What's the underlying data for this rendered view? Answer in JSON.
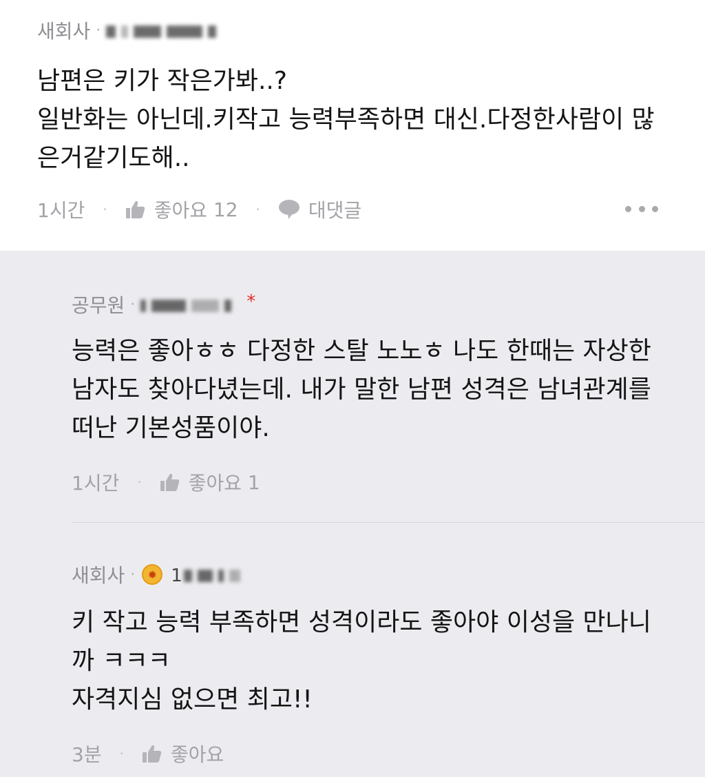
{
  "comments": [
    {
      "author_role": "새회사",
      "body_lines": [
        "남편은 키가 작은가봐..?",
        "일반화는 아닌데.키작고 능력부족하면 대신.다정한사람이 많",
        "은거같기도해.."
      ],
      "time": "1시간",
      "like_label": "좋아요",
      "like_count": "12",
      "reply_label": "대댓글"
    }
  ],
  "replies": [
    {
      "author_role": "공무원",
      "body_lines": [
        "능력은 좋아ㅎㅎ 다정한 스탈 노노ㅎ 나도 한때는 자상한",
        "남자도 찾아다녔는데. 내가 말한 남편 성격은 남녀관계를",
        "떠난 기본성품이야."
      ],
      "time": "1시간",
      "like_label": "좋아요",
      "like_count": "1",
      "author_mark": "*"
    },
    {
      "author_role": "새회사",
      "author_name_prefix": "1",
      "body_lines": [
        "키 작고 능력 부족하면 성격이라도 좋아야 이성을 만나니",
        "까 ㅋㅋㅋ",
        "자격지심 없으면 최고!!"
      ],
      "time": "3분",
      "like_label": "좋아요",
      "like_count": ""
    }
  ],
  "separators": {
    "dot": "·"
  },
  "icons": {
    "like": "thumbs-up-icon",
    "reply": "speech-bubble-icon",
    "more": "more-horizontal-icon",
    "badge": "sun-badge-icon"
  },
  "colors": {
    "reply_background": "#ececf0",
    "meta_text": "#8e8e93",
    "action_text": "#a2a2a7",
    "asterisk": "#e0302a",
    "badge": "#f2b630"
  }
}
